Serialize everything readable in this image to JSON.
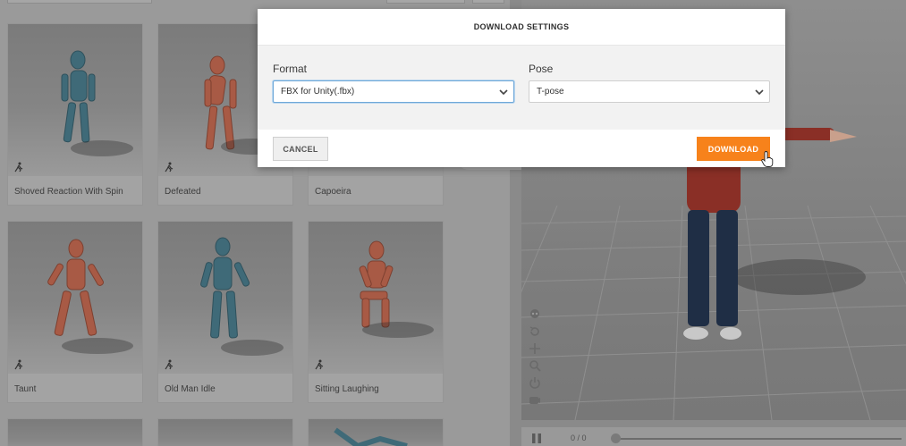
{
  "library": {
    "cards": [
      {
        "label": "Shoved Reaction With Spin",
        "figure_color": "#3f6a78"
      },
      {
        "label": "Defeated",
        "figure_color": "#a85a45"
      },
      {
        "label": "Capoeira",
        "figure_color": "#a85a45"
      },
      {
        "label": "Taunt",
        "figure_color": "#a85a45"
      },
      {
        "label": "Old Man Idle",
        "figure_color": "#3f6a78"
      },
      {
        "label": "Sitting Laughing",
        "figure_color": "#a85a45"
      }
    ]
  },
  "viewer": {
    "tools": [
      "skeleton-icon",
      "reset-icon",
      "move-icon",
      "zoom-icon",
      "power-icon",
      "camera-icon"
    ]
  },
  "player": {
    "frame_counter": "0 / 0"
  },
  "modal": {
    "title": "DOWNLOAD SETTINGS",
    "format_label": "Format",
    "format_value": "FBX for Unity(.fbx)",
    "pose_label": "Pose",
    "pose_value": "T-pose",
    "cancel_label": "CANCEL",
    "download_label": "DOWNLOAD",
    "accent": "#f7821b"
  }
}
